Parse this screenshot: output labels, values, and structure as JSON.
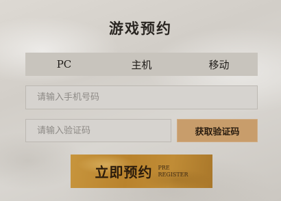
{
  "title": "游戏预约",
  "tabs": [
    {
      "label": "PC"
    },
    {
      "label": "主机"
    },
    {
      "label": "移动"
    }
  ],
  "phone_input": {
    "placeholder": "请输入手机号码",
    "value": ""
  },
  "code_input": {
    "placeholder": "请输入验证码",
    "value": ""
  },
  "get_code_button": {
    "label": "获取验证码"
  },
  "preregister_button": {
    "label": "立即预约",
    "sub_line1": "PRE",
    "sub_line2": "REGISTER"
  },
  "colors": {
    "get_code_bg": "#c89d6b",
    "cta_gold": "#b9832d",
    "tab_bar_bg": "#c8c4bd"
  }
}
